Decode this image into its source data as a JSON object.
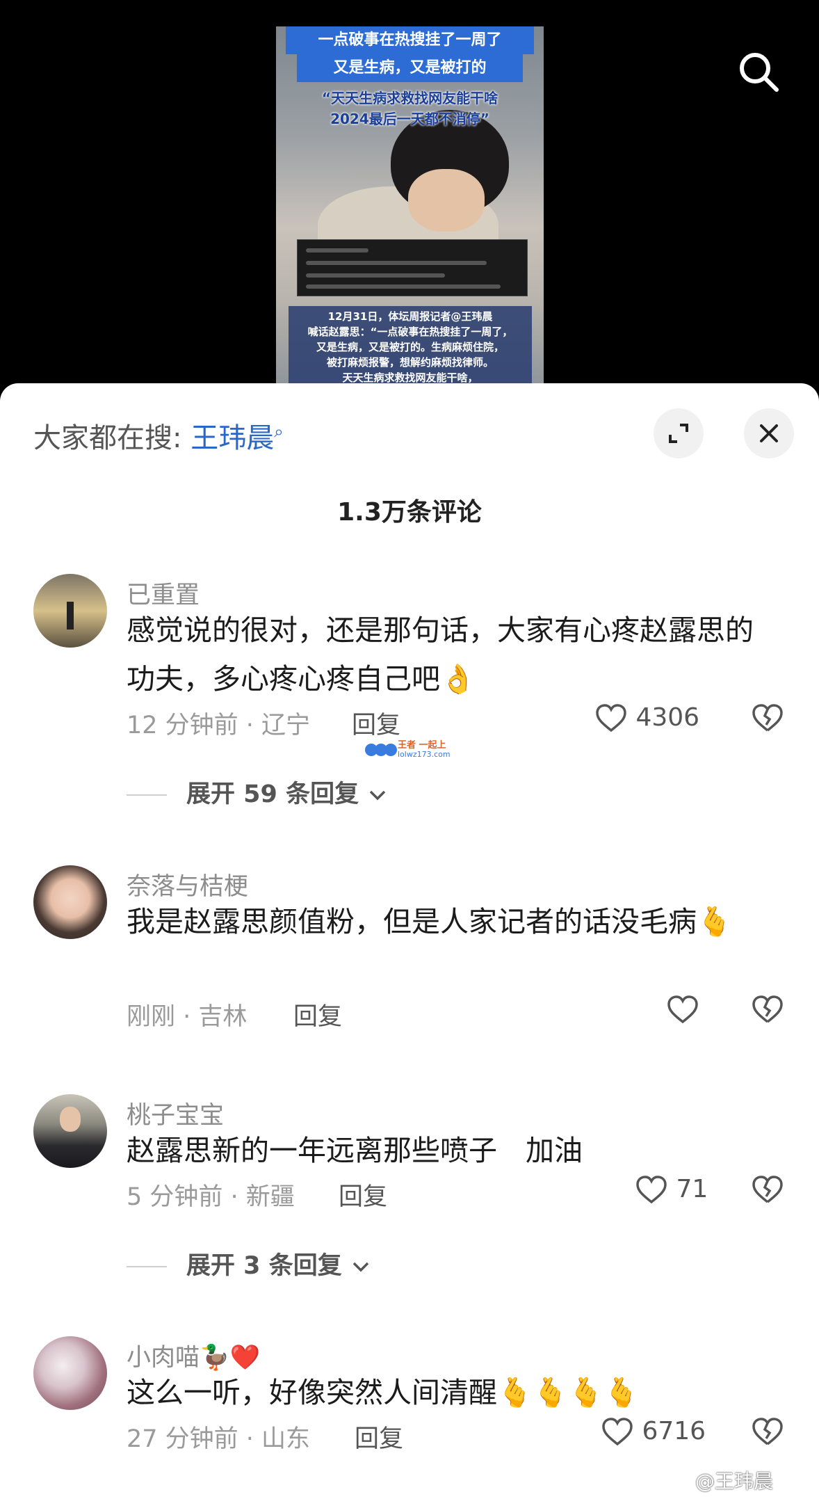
{
  "video": {
    "banner_line1": "一点破事在热搜挂了一周了",
    "banner_line2": "又是生病，又是被打的",
    "quote_line1": "“天天生病求救找网友能干啥",
    "quote_line2": "2024最后一天都不消停”",
    "caption_line1": "12月31日，体坛周报记者@王玮晨",
    "caption_line2": "喊话赵露思：“一点破事在热搜挂了一周了，",
    "caption_line3": "又是生病，又是被打的。生病麻烦住院，",
    "caption_line4": "被打麻烦报警，想解约麻烦找律师。",
    "caption_line5": "天天生病求救找网友能干啥，"
  },
  "search_hint": {
    "label": "大家都在搜:",
    "keyword": "王玮晨"
  },
  "comment_count": "1.3万条评论",
  "comments": [
    {
      "username": "已重置",
      "text": "感觉说的很对，还是那句话，大家有心疼赵露思的功夫，多心疼心疼自己吧👌",
      "meta": "12 分钟前 · 辽宁",
      "reply": "回复",
      "likes": "4306",
      "expand": "展开 59 条回复"
    },
    {
      "username": "奈落与桔梗",
      "text": "我是赵露思颜值粉，但是人家记者的话没毛病🫰",
      "meta": "刚刚 · 吉林",
      "reply": "回复",
      "likes": ""
    },
    {
      "username": "桃子宝宝",
      "text": "赵露思新的一年远离那些喷子　加油",
      "meta": "5 分钟前 · 新疆",
      "reply": "回复",
      "likes": "71",
      "expand": "展开 3 条回复"
    },
    {
      "username": "小肉喵🦆❤️",
      "text": "这么一听，好像突然人间清醒🫰🫰🫰🫰",
      "meta": "27 分钟前 · 山东",
      "reply": "回复",
      "likes": "6716"
    }
  ],
  "watermark": {
    "logo_text": "王者 一起上",
    "logo_sub": "lolwz173.com",
    "weibo": "@王玮晨"
  },
  "colors": {
    "keyword_blue": "#2a67c8",
    "banner_blue": "#2c6cd4"
  }
}
